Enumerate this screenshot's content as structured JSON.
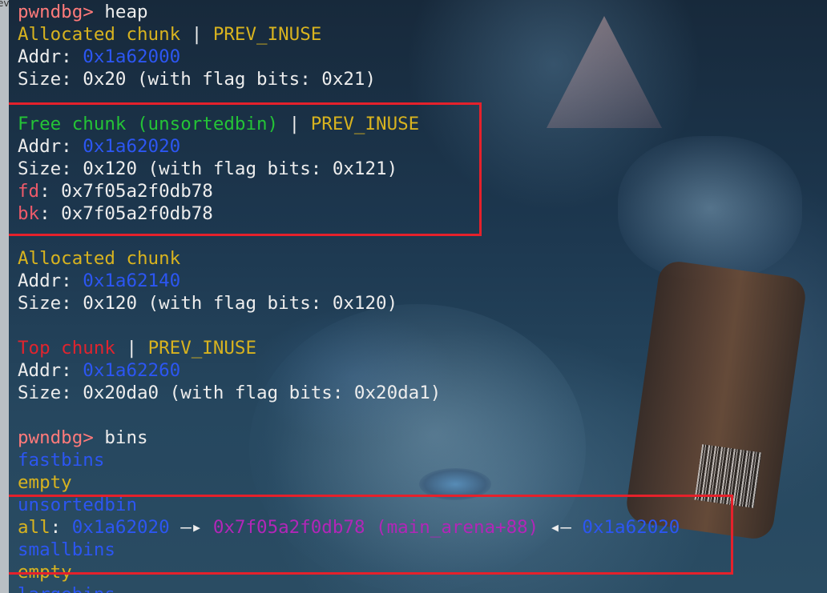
{
  "left_strip_text": "ev",
  "terminal": {
    "lines": [
      [
        {
          "t": "pwndbg> ",
          "c": "prompt"
        },
        {
          "t": "heap",
          "c": "white"
        }
      ],
      [
        {
          "t": "Allocated chunk",
          "c": "yellow"
        },
        {
          "t": " | ",
          "c": "white"
        },
        {
          "t": "PREV_INUSE",
          "c": "yellow"
        }
      ],
      [
        {
          "t": "Addr: ",
          "c": "white"
        },
        {
          "t": "0x1a62000",
          "c": "blue"
        }
      ],
      [
        {
          "t": "Size: 0x20 (with flag bits: 0x21)",
          "c": "white"
        }
      ],
      [
        {
          "t": "",
          "c": "white"
        }
      ],
      [
        {
          "t": "Free chunk (unsortedbin)",
          "c": "green"
        },
        {
          "t": " | ",
          "c": "white"
        },
        {
          "t": "PREV_INUSE",
          "c": "yellow"
        }
      ],
      [
        {
          "t": "Addr: ",
          "c": "white"
        },
        {
          "t": "0x1a62020",
          "c": "blue"
        }
      ],
      [
        {
          "t": "Size: 0x120 (with flag bits: 0x121)",
          "c": "white"
        }
      ],
      [
        {
          "t": "fd",
          "c": "fdbk"
        },
        {
          "t": ": 0x7f05a2f0db78",
          "c": "white"
        }
      ],
      [
        {
          "t": "bk",
          "c": "fdbk"
        },
        {
          "t": ": 0x7f05a2f0db78",
          "c": "white"
        }
      ],
      [
        {
          "t": "",
          "c": "white"
        }
      ],
      [
        {
          "t": "Allocated chunk",
          "c": "yellow"
        }
      ],
      [
        {
          "t": "Addr: ",
          "c": "white"
        },
        {
          "t": "0x1a62140",
          "c": "blue"
        }
      ],
      [
        {
          "t": "Size: 0x120 (with flag bits: 0x120)",
          "c": "white"
        }
      ],
      [
        {
          "t": "",
          "c": "white"
        }
      ],
      [
        {
          "t": "Top chunk",
          "c": "red"
        },
        {
          "t": " | ",
          "c": "white"
        },
        {
          "t": "PREV_INUSE",
          "c": "yellow"
        }
      ],
      [
        {
          "t": "Addr: ",
          "c": "white"
        },
        {
          "t": "0x1a62260",
          "c": "blue"
        }
      ],
      [
        {
          "t": "Size: 0x20da0 (with flag bits: 0x20da1)",
          "c": "white"
        }
      ],
      [
        {
          "t": "",
          "c": "white"
        }
      ],
      [
        {
          "t": "pwndbg> ",
          "c": "prompt"
        },
        {
          "t": "bins",
          "c": "white"
        }
      ],
      [
        {
          "t": "fastbins",
          "c": "blue"
        }
      ],
      [
        {
          "t": "empty",
          "c": "yellow"
        }
      ],
      [
        {
          "t": "unsortedbin",
          "c": "blue"
        }
      ],
      [
        {
          "t": "all",
          "c": "yellow"
        },
        {
          "t": ": ",
          "c": "white"
        },
        {
          "t": "0x1a62020",
          "c": "blue"
        },
        {
          "t": " —▸ ",
          "c": "white"
        },
        {
          "t": "0x7f05a2f0db78 (main_arena+88)",
          "c": "magenta"
        },
        {
          "t": " ◂— ",
          "c": "white"
        },
        {
          "t": "0x1a62020",
          "c": "blue"
        }
      ],
      [
        {
          "t": "smallbins",
          "c": "blue"
        }
      ],
      [
        {
          "t": "empty",
          "c": "yellow"
        }
      ],
      [
        {
          "t": "largebins",
          "c": "blue"
        }
      ]
    ]
  },
  "colors": {
    "prompt": "#ff7a7a",
    "white": "#ededed",
    "yellow": "#d8b31f",
    "green": "#24c436",
    "blue": "#2c56f2",
    "red": "#e0242e",
    "magenta": "#b226b8",
    "fdbk": "#ee5a6a",
    "highlight_box": "#e5212b"
  }
}
